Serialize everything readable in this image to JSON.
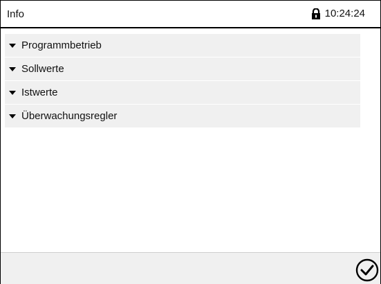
{
  "header": {
    "title": "Info",
    "time": "10:24:24",
    "lock_icon": "lock-icon"
  },
  "menu": {
    "items": [
      {
        "label": "Programmbetrieb",
        "icon": "triangle-down-icon"
      },
      {
        "label": "Sollwerte",
        "icon": "triangle-down-icon"
      },
      {
        "label": "Istwerte",
        "icon": "triangle-down-icon"
      },
      {
        "label": "Überwachungsregler",
        "icon": "triangle-down-icon"
      }
    ]
  },
  "footer": {
    "confirm_icon": "checkmark-circle-icon"
  }
}
